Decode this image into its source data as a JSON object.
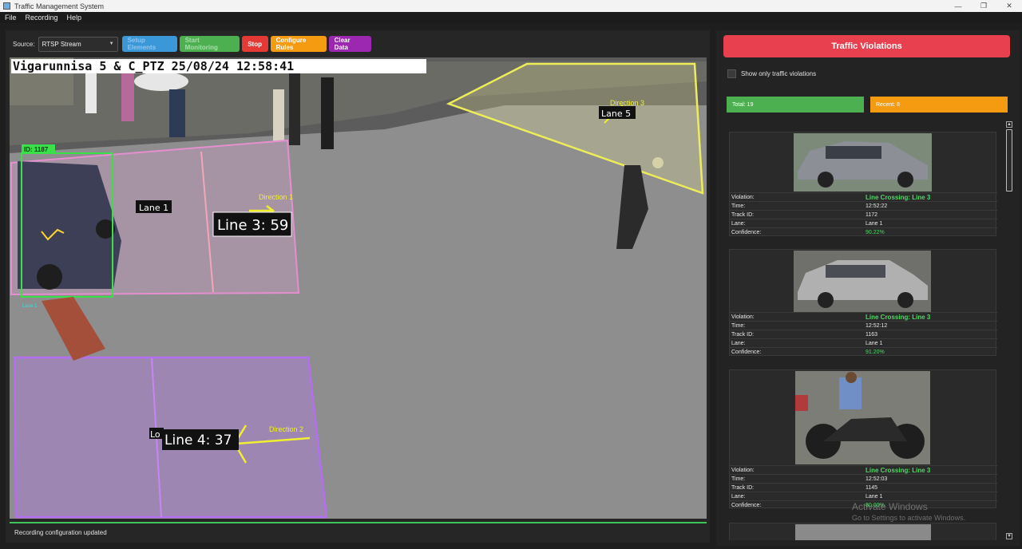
{
  "window": {
    "title": "Traffic Management System",
    "min": "—",
    "max": "❐",
    "close": "✕"
  },
  "menu": [
    "File",
    "Recording",
    "Help"
  ],
  "toolbar": {
    "source_label": "Source:",
    "source_value": "RTSP Stream",
    "setup_label": "Setup Elements",
    "start_label": "Start Monitoring",
    "stop_label": "Stop",
    "rules_label": "Configure Rules",
    "clear_label": "Clear Data"
  },
  "video": {
    "osd": "Vigarunnisa 5 & C_PTZ   25/08/24   12:58:41",
    "track_id": "ID: 1187",
    "lane1": "Lane 1",
    "line3": "Line 3: 59",
    "direction1": "Direction 1",
    "lane5": "Lane 5",
    "direction3": "Direction 3",
    "line4": "Line 4: 37",
    "direction2": "Direction 2",
    "lane_small": "Lane 1",
    "lane_partial": "Lo"
  },
  "status": "Recording configuration updated",
  "panel": {
    "title": "Traffic Violations",
    "filter_label": "Show only traffic violations",
    "total": "Total: 19",
    "recent": "Recent: 8"
  },
  "field_labels": {
    "violation": "Violation:",
    "time": "Time:",
    "track": "Track ID:",
    "lane": "Lane:",
    "confidence": "Confidence:"
  },
  "violations": [
    {
      "type": "Line Crossing: Line 3",
      "time": "12:52:22",
      "track_id": "1172",
      "lane": "Lane 1",
      "confidence": "90.22%",
      "vehicle": "car-gray"
    },
    {
      "type": "Line Crossing: Line 3",
      "time": "12:52:12",
      "track_id": "1163",
      "lane": "Lane 1",
      "confidence": "91.20%",
      "vehicle": "car-silver"
    },
    {
      "type": "Line Crossing: Line 3",
      "time": "12:52:03",
      "track_id": "1145",
      "lane": "Lane 1",
      "confidence": "80.00%",
      "vehicle": "motorcycle"
    }
  ],
  "watermark": {
    "line1": "Activate Windows",
    "line2": "Go to Settings to activate Windows."
  },
  "colors": {
    "accent_red": "#e8404f",
    "total_green": "#4caf50",
    "recent_orange": "#f59b12",
    "zone_pink": "#e8a6d6",
    "zone_purple": "#b36ff0",
    "zone_yellow": "#f2f26a",
    "box_green": "#39e04a"
  }
}
